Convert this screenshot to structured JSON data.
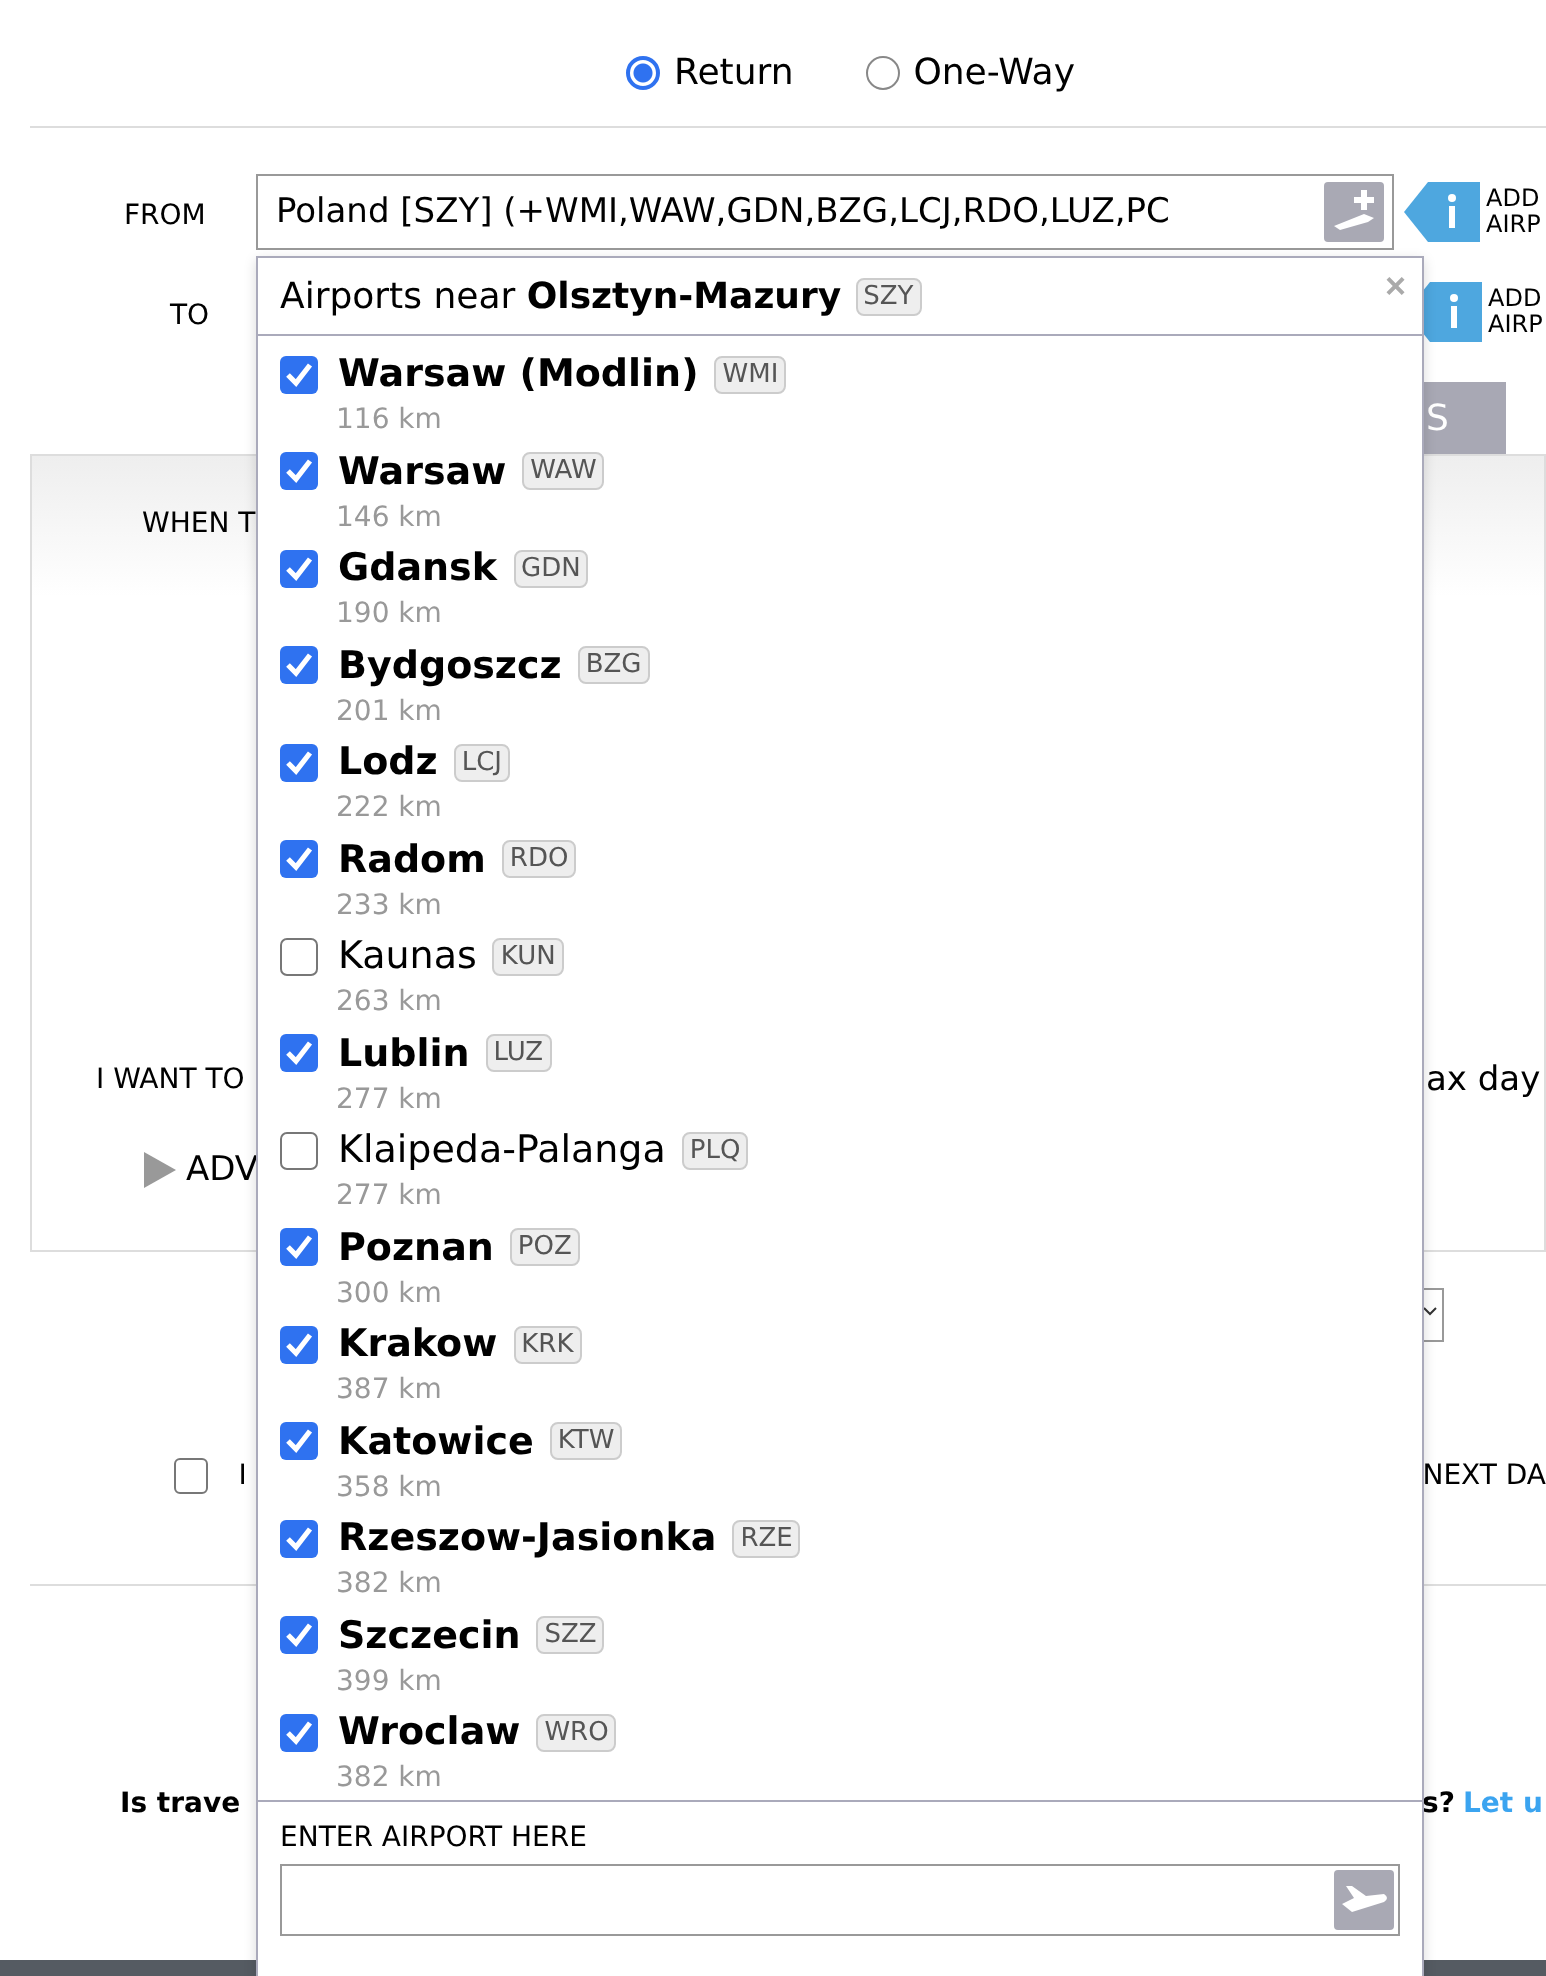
{
  "trip_type": [
    {
      "label": "Return",
      "selected": true
    },
    {
      "label": "One-Way",
      "selected": false
    }
  ],
  "from": {
    "label": "FROM",
    "value": "Poland [SZY] (+WMI,WAW,GDN,BZG,LCJ,RDO,LUZ,PC"
  },
  "to": {
    "label": "TO"
  },
  "add_airport_hints": [
    "ADD AIRP",
    "ADD AIRP"
  ],
  "search_button": "S",
  "when_label": "WHEN T",
  "want_label": "I WANT TO",
  "max_days_text": "ax day",
  "advanced_label": "ADV",
  "option_checkbox": {
    "label": "I",
    "checked": false
  },
  "next_day_text": "NEXT DA",
  "footer": {
    "question": "Is trave",
    "question_end": "s?",
    "link": "Let u"
  },
  "dropdown": {
    "title": "Airports near **Olsztyn-Mazury**",
    "title_code": "SZY",
    "close": "×",
    "enter_label": "ENTER AIRPORT HERE",
    "airports": [
      {
        "name": "Warsaw (Modlin)",
        "code": "WMI",
        "distance": "116 km",
        "checked": true
      },
      {
        "name": "Warsaw",
        "code": "WAW",
        "distance": "146 km",
        "checked": true
      },
      {
        "name": "Gdansk",
        "code": "GDN",
        "distance": "190 km",
        "checked": true
      },
      {
        "name": "Bydgoszcz",
        "code": "BZG",
        "distance": "201 km",
        "checked": true
      },
      {
        "name": "Lodz",
        "code": "LCJ",
        "distance": "222 km",
        "checked": true
      },
      {
        "name": "Radom",
        "code": "RDO",
        "distance": "233 km",
        "checked": true
      },
      {
        "name": "Kaunas",
        "code": "KUN",
        "distance": "263 km",
        "checked": false
      },
      {
        "name": "Lublin",
        "code": "LUZ",
        "distance": "277 km",
        "checked": true
      },
      {
        "name": "Klaipeda-Palanga",
        "code": "PLQ",
        "distance": "277 km",
        "checked": false
      },
      {
        "name": "Poznan",
        "code": "POZ",
        "distance": "300 km",
        "checked": true
      },
      {
        "name": "Krakow",
        "code": "KRK",
        "distance": "387 km",
        "checked": true
      },
      {
        "name": "Katowice",
        "code": "KTW",
        "distance": "358 km",
        "checked": true
      },
      {
        "name": "Rzeszow-Jasionka",
        "code": "RZE",
        "distance": "382 km",
        "checked": true
      },
      {
        "name": "Szczecin",
        "code": "SZZ",
        "distance": "399 km",
        "checked": true
      },
      {
        "name": "Wroclaw",
        "code": "WRO",
        "distance": "382 km",
        "checked": true
      }
    ]
  }
}
